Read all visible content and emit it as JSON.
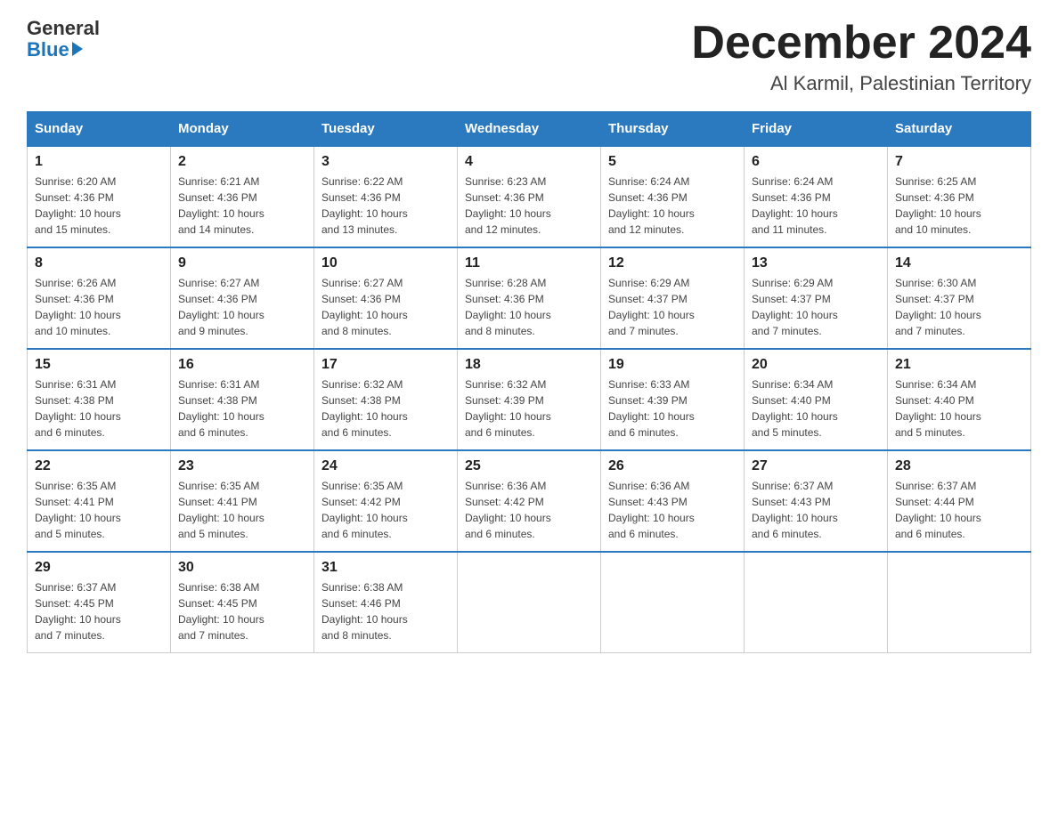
{
  "header": {
    "logo_general": "General",
    "logo_blue": "Blue",
    "month_title": "December 2024",
    "subtitle": "Al Karmil, Palestinian Territory"
  },
  "days_of_week": [
    "Sunday",
    "Monday",
    "Tuesday",
    "Wednesday",
    "Thursday",
    "Friday",
    "Saturday"
  ],
  "weeks": [
    [
      {
        "day": "1",
        "sunrise": "6:20 AM",
        "sunset": "4:36 PM",
        "daylight": "10 hours and 15 minutes."
      },
      {
        "day": "2",
        "sunrise": "6:21 AM",
        "sunset": "4:36 PM",
        "daylight": "10 hours and 14 minutes."
      },
      {
        "day": "3",
        "sunrise": "6:22 AM",
        "sunset": "4:36 PM",
        "daylight": "10 hours and 13 minutes."
      },
      {
        "day": "4",
        "sunrise": "6:23 AM",
        "sunset": "4:36 PM",
        "daylight": "10 hours and 12 minutes."
      },
      {
        "day": "5",
        "sunrise": "6:24 AM",
        "sunset": "4:36 PM",
        "daylight": "10 hours and 12 minutes."
      },
      {
        "day": "6",
        "sunrise": "6:24 AM",
        "sunset": "4:36 PM",
        "daylight": "10 hours and 11 minutes."
      },
      {
        "day": "7",
        "sunrise": "6:25 AM",
        "sunset": "4:36 PM",
        "daylight": "10 hours and 10 minutes."
      }
    ],
    [
      {
        "day": "8",
        "sunrise": "6:26 AM",
        "sunset": "4:36 PM",
        "daylight": "10 hours and 10 minutes."
      },
      {
        "day": "9",
        "sunrise": "6:27 AM",
        "sunset": "4:36 PM",
        "daylight": "10 hours and 9 minutes."
      },
      {
        "day": "10",
        "sunrise": "6:27 AM",
        "sunset": "4:36 PM",
        "daylight": "10 hours and 8 minutes."
      },
      {
        "day": "11",
        "sunrise": "6:28 AM",
        "sunset": "4:36 PM",
        "daylight": "10 hours and 8 minutes."
      },
      {
        "day": "12",
        "sunrise": "6:29 AM",
        "sunset": "4:37 PM",
        "daylight": "10 hours and 7 minutes."
      },
      {
        "day": "13",
        "sunrise": "6:29 AM",
        "sunset": "4:37 PM",
        "daylight": "10 hours and 7 minutes."
      },
      {
        "day": "14",
        "sunrise": "6:30 AM",
        "sunset": "4:37 PM",
        "daylight": "10 hours and 7 minutes."
      }
    ],
    [
      {
        "day": "15",
        "sunrise": "6:31 AM",
        "sunset": "4:38 PM",
        "daylight": "10 hours and 6 minutes."
      },
      {
        "day": "16",
        "sunrise": "6:31 AM",
        "sunset": "4:38 PM",
        "daylight": "10 hours and 6 minutes."
      },
      {
        "day": "17",
        "sunrise": "6:32 AM",
        "sunset": "4:38 PM",
        "daylight": "10 hours and 6 minutes."
      },
      {
        "day": "18",
        "sunrise": "6:32 AM",
        "sunset": "4:39 PM",
        "daylight": "10 hours and 6 minutes."
      },
      {
        "day": "19",
        "sunrise": "6:33 AM",
        "sunset": "4:39 PM",
        "daylight": "10 hours and 6 minutes."
      },
      {
        "day": "20",
        "sunrise": "6:34 AM",
        "sunset": "4:40 PM",
        "daylight": "10 hours and 5 minutes."
      },
      {
        "day": "21",
        "sunrise": "6:34 AM",
        "sunset": "4:40 PM",
        "daylight": "10 hours and 5 minutes."
      }
    ],
    [
      {
        "day": "22",
        "sunrise": "6:35 AM",
        "sunset": "4:41 PM",
        "daylight": "10 hours and 5 minutes."
      },
      {
        "day": "23",
        "sunrise": "6:35 AM",
        "sunset": "4:41 PM",
        "daylight": "10 hours and 5 minutes."
      },
      {
        "day": "24",
        "sunrise": "6:35 AM",
        "sunset": "4:42 PM",
        "daylight": "10 hours and 6 minutes."
      },
      {
        "day": "25",
        "sunrise": "6:36 AM",
        "sunset": "4:42 PM",
        "daylight": "10 hours and 6 minutes."
      },
      {
        "day": "26",
        "sunrise": "6:36 AM",
        "sunset": "4:43 PM",
        "daylight": "10 hours and 6 minutes."
      },
      {
        "day": "27",
        "sunrise": "6:37 AM",
        "sunset": "4:43 PM",
        "daylight": "10 hours and 6 minutes."
      },
      {
        "day": "28",
        "sunrise": "6:37 AM",
        "sunset": "4:44 PM",
        "daylight": "10 hours and 6 minutes."
      }
    ],
    [
      {
        "day": "29",
        "sunrise": "6:37 AM",
        "sunset": "4:45 PM",
        "daylight": "10 hours and 7 minutes."
      },
      {
        "day": "30",
        "sunrise": "6:38 AM",
        "sunset": "4:45 PM",
        "daylight": "10 hours and 7 minutes."
      },
      {
        "day": "31",
        "sunrise": "6:38 AM",
        "sunset": "4:46 PM",
        "daylight": "10 hours and 8 minutes."
      },
      null,
      null,
      null,
      null
    ]
  ],
  "labels": {
    "sunrise": "Sunrise:",
    "sunset": "Sunset:",
    "daylight": "Daylight:"
  }
}
